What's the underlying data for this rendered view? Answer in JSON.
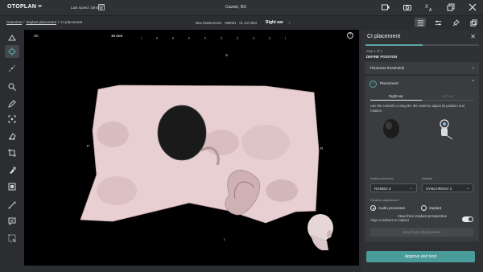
{
  "app": {
    "logo": "OTOPLAN",
    "last_saved": "Last saved: 18min",
    "patient_case": "Cavum, RS",
    "top_icons": [
      "screen-record-icon",
      "camera-icon",
      "translate-icon",
      "restore-window-icon",
      "close-window-icon"
    ]
  },
  "breadcrumb": {
    "items": [
      "Overview",
      "Implant placement",
      "CI placement"
    ],
    "separator": "/"
  },
  "patient": {
    "name": "Max Mustermann",
    "id": "MM001",
    "dob": "01 Jul 1964"
  },
  "ear_select": {
    "value": "Right ear"
  },
  "viewport": {
    "mode_label": "3D",
    "scale_label": "10 mm",
    "orientation": {
      "top": "S",
      "left": "P",
      "right": "R",
      "bottom": "I"
    },
    "help": "?"
  },
  "panel": {
    "title": "CI placement",
    "progress": 0.5,
    "step": "Step 1 of 2",
    "step_title": "DEFINE POSITION",
    "thickness": "Thickness thresholds",
    "placement": {
      "label": "Placement",
      "tabs": [
        "Right ear",
        "Left ear"
      ],
      "active_tab": "Right ear",
      "description": "Use the controls or drag the 3D model to adjust its position and rotation.",
      "audio_processor_label": "Audio processor",
      "audio_processor_value": "RONDO 3",
      "implant_label": "Implant",
      "implant_value": "SYNCHRONY 2",
      "rotation_label": "Rotation adjustment",
      "rotation_options": [
        "Audio processor",
        "Implant"
      ],
      "rotation_selected": "Audio processor",
      "align_label": "Align crosshairs to implant",
      "align_on": true,
      "move_button": "Move from left placement"
    },
    "view_from_implant": "View from implant perspective",
    "approve_button": "Approve and next"
  },
  "colors": {
    "accent": "#4a9c9a",
    "background": "#2b2d30",
    "panel": "#2f3134",
    "viewport": "#000000",
    "bone": "#e8d0d2"
  }
}
